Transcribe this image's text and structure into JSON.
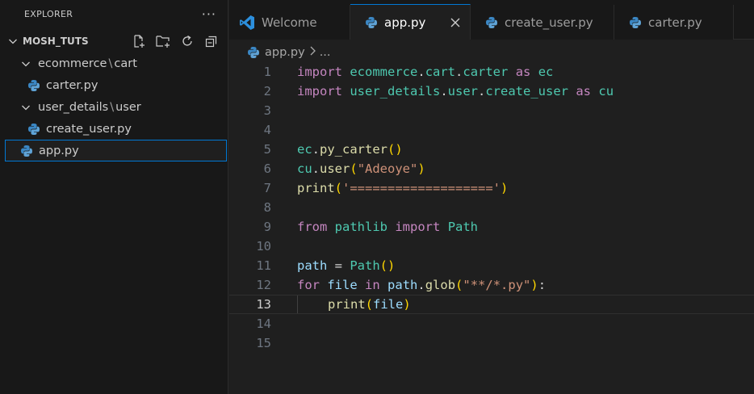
{
  "explorer": {
    "title": "EXPLORER",
    "more": "···",
    "folder": "MOSH_TUTS",
    "tree": [
      {
        "label": "ecommerce",
        "sep": "\\",
        "label2": "cart"
      },
      {
        "label": "carter.py"
      },
      {
        "label": "user_details",
        "sep": "\\",
        "label2": "user"
      },
      {
        "label": "create_user.py"
      },
      {
        "label": "app.py"
      }
    ]
  },
  "tabs": [
    {
      "label": "Welcome"
    },
    {
      "label": "app.py"
    },
    {
      "label": "create_user.py"
    },
    {
      "label": "carter.py"
    }
  ],
  "breadcrumb": {
    "file": "app.py",
    "rest": "..."
  },
  "editor": {
    "line_numbers": [
      "1",
      "2",
      "3",
      "4",
      "5",
      "6",
      "7",
      "8",
      "9",
      "10",
      "11",
      "12",
      "13",
      "14",
      "15"
    ],
    "current_line": "13",
    "lines": {
      "l1": [
        "import",
        "ecommerce",
        ".",
        "cart",
        ".",
        "carter",
        "as",
        "ec"
      ],
      "l2": [
        "import",
        "user_details",
        ".",
        "user",
        ".",
        "create_user",
        "as",
        "cu"
      ],
      "l5": [
        "ec",
        ".",
        "py_carter",
        "(",
        ")"
      ],
      "l6": [
        "cu",
        ".",
        "user",
        "(",
        "\"Adeoye\"",
        ")"
      ],
      "l7": [
        "print",
        "(",
        "'==================='",
        ")"
      ],
      "l9": [
        "from",
        "pathlib",
        "import",
        "Path"
      ],
      "l11": [
        "path",
        " = ",
        "Path",
        "(",
        ")"
      ],
      "l12": [
        "for",
        "file",
        "in",
        "path",
        ".",
        "glob",
        "(",
        "\"**/*.py\"",
        ")",
        ":"
      ],
      "l13": [
        "print",
        "(",
        "file",
        ")"
      ]
    }
  },
  "colors": {
    "accent": "#0078d4",
    "keyword": "#c586c0",
    "module": "#4ec9b0",
    "function": "#dcdcaa",
    "variable": "#9cdcfe",
    "string": "#ce9178"
  }
}
